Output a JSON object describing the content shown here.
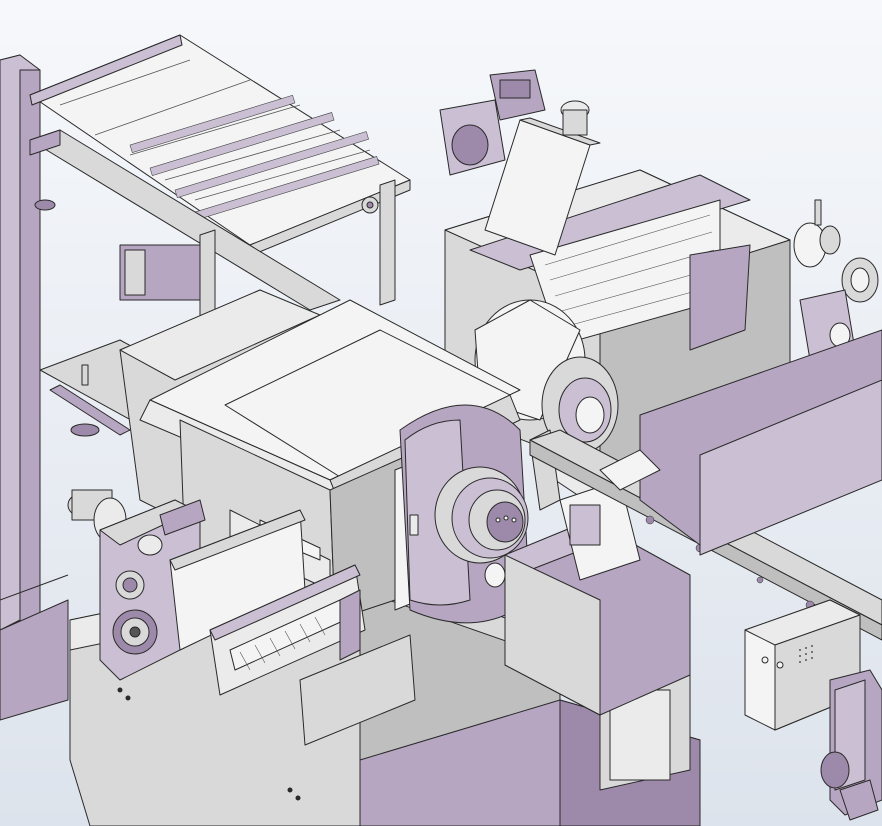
{
  "viewport": {
    "kind": "cad-3d-assembly-render",
    "background_top": "#f6f8fb",
    "background_bottom": "#dde3ec"
  },
  "palette": {
    "body": "#b7a6c1",
    "body_light": "#cbbfd3",
    "body_dark": "#9d8aaa",
    "edge": "#2a2a2a",
    "gray": "#d9d9d9",
    "gray_light": "#ebebeb",
    "gray_dark": "#bfbfbf",
    "white": "#f4f4f4"
  },
  "components": [
    {
      "name": "left-cabinet",
      "icon": "cabinet-icon"
    },
    {
      "name": "infeed-conveyor-tray",
      "icon": "conveyor-icon"
    },
    {
      "name": "headstock-motor",
      "icon": "motor-icon"
    },
    {
      "name": "spindle-guard-housing",
      "icon": "enclosure-icon"
    },
    {
      "name": "main-spindle-chuck",
      "icon": "chuck-icon"
    },
    {
      "name": "grinding-wheel-head",
      "icon": "wheel-icon"
    },
    {
      "name": "transfer-rail",
      "icon": "rail-icon"
    },
    {
      "name": "gear-drive-unit",
      "icon": "gear-icon"
    },
    {
      "name": "linear-slide-carriage",
      "icon": "slide-icon"
    },
    {
      "name": "electrical-box",
      "icon": "junction-box-icon"
    },
    {
      "name": "machine-base",
      "icon": "base-icon"
    }
  ]
}
